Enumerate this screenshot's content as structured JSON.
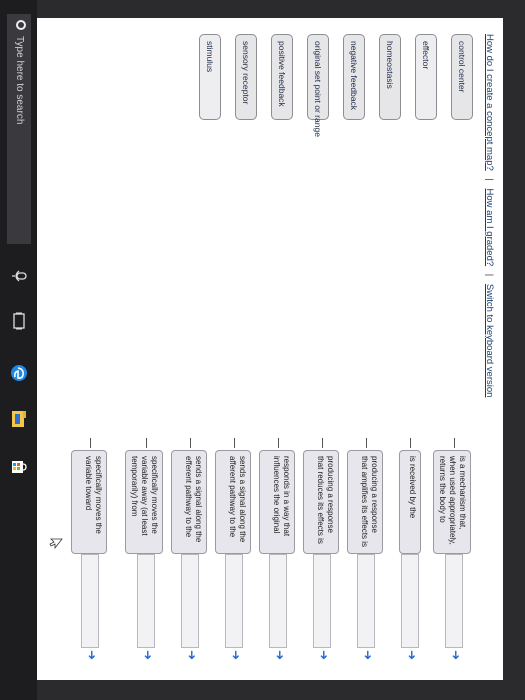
{
  "top_links": {
    "how_create": "How do I create a concept map?",
    "how_graded": "How am I graded?",
    "switch_keyboard": "Switch to keyboard version"
  },
  "terms": [
    "control center",
    "effector",
    "homeostasis",
    "negative feedback",
    "original set point or range",
    "positive feedback",
    "sensory receptor",
    "stimulus"
  ],
  "relations": [
    {
      "text": "is a mechanism that, when used appropriately, returns the body to"
    },
    {
      "text": "is received by the"
    },
    {
      "text": "producing a response that amplifies its effects is"
    },
    {
      "text": "producing a response that reduces its effects is"
    },
    {
      "text": "responds in a way that influences the original"
    },
    {
      "text": "sends a signal along the afferent pathway to the"
    },
    {
      "text": "sends a signal along the efferent pathway to the"
    },
    {
      "text": "specifically moves the variable away (at least temporarily) from"
    },
    {
      "text": "specifically moves the variable toward"
    }
  ],
  "taskbar": {
    "search_placeholder": "Type here to search",
    "icons": [
      "search-circle-icon",
      "mic-icon",
      "task-view-icon",
      "edge-browser-icon",
      "file-explorer-icon",
      "store-icon"
    ]
  },
  "colors": {
    "link": "#1b3f6b",
    "arrow": "#2a6ad8",
    "taskbar": "#1d1d20"
  }
}
